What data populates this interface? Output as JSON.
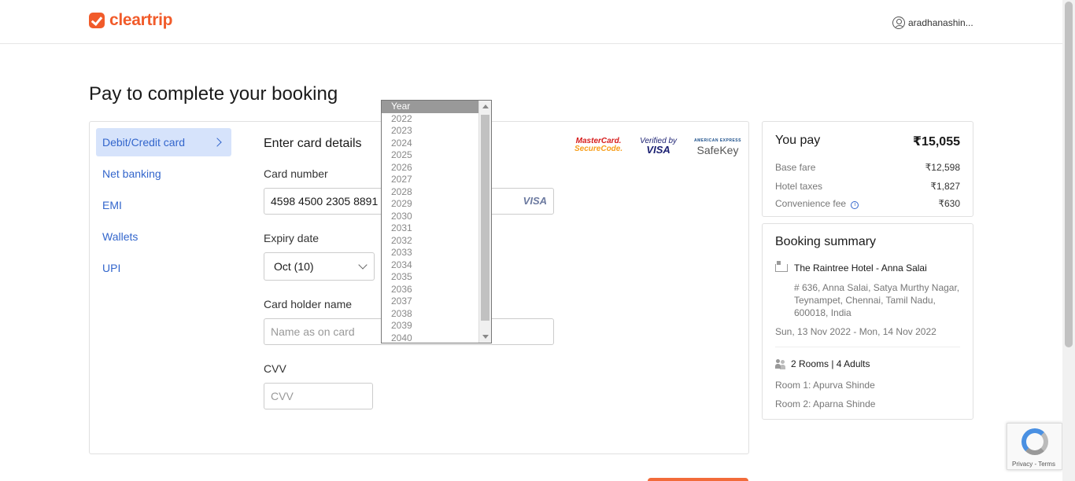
{
  "brand": {
    "name": "cleartrip",
    "color": "#f15b2a"
  },
  "header": {
    "user_name": "aradhanashin..."
  },
  "page": {
    "title": "Pay to complete your booking"
  },
  "payment_methods": [
    {
      "label": "Debit/Credit card",
      "active": true
    },
    {
      "label": "Net banking"
    },
    {
      "label": "EMI"
    },
    {
      "label": "Wallets"
    },
    {
      "label": "UPI"
    }
  ],
  "card_form": {
    "heading": "Enter card details",
    "card_number_label": "Card number",
    "card_number_value": "4598 4500 2305 8891",
    "card_brand": "VISA",
    "expiry_label": "Expiry date",
    "expiry_month_value": "Oct (10)",
    "holder_label": "Card holder name",
    "holder_placeholder": "Name as on card",
    "cvv_label": "CVV",
    "cvv_placeholder": "CVV"
  },
  "security_logos": {
    "mastercard_line1": "MasterCard.",
    "mastercard_line2": "SecureCode.",
    "visa_line1": "Verified by",
    "visa_line2": "VISA",
    "amex_line1": "AMERICAN EXPRESS",
    "amex_line2": "SafeKey"
  },
  "year_dropdown": {
    "options": [
      "Year",
      "2022",
      "2023",
      "2024",
      "2025",
      "2026",
      "2027",
      "2028",
      "2029",
      "2030",
      "2031",
      "2032",
      "2033",
      "2034",
      "2035",
      "2036",
      "2037",
      "2038",
      "2039",
      "2040"
    ],
    "selected": "Year"
  },
  "fare": {
    "title": "You pay",
    "total": "₹15,055",
    "rows": [
      {
        "label": "Base fare",
        "value": "₹12,598"
      },
      {
        "label": "Hotel taxes",
        "value": "₹1,827"
      },
      {
        "label": "Convenience fee",
        "value": "₹630",
        "info": "i"
      }
    ]
  },
  "summary": {
    "title": "Booking summary",
    "hotel_name": "The Raintree Hotel - Anna Salai",
    "address": "# 636, Anna Salai, Satya Murthy Nagar, Teynampet, Chennai, Tamil Nadu, 600018, India",
    "dates": "Sun, 13 Nov 2022 - Mon, 14 Nov 2022",
    "guests": "2 Rooms | 4 Adults",
    "rooms": [
      "Room 1: Apurva Shinde",
      "Room 2: Aparna Shinde"
    ]
  },
  "recaptcha": {
    "text": "Privacy - Terms"
  }
}
